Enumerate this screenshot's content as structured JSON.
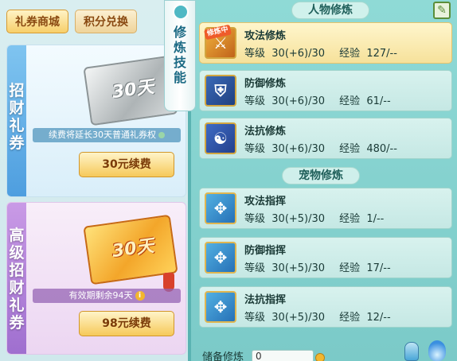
{
  "tabs": {
    "shop": "礼券商城",
    "points": "积分兑换"
  },
  "shop_cards": [
    {
      "side_label": [
        "招",
        "财",
        "礼",
        "券"
      ],
      "ticket_label": "30天",
      "info": "续费将延长30天普通礼券权",
      "button": "30元续费"
    },
    {
      "side_label": [
        "高",
        "级",
        "招",
        "财",
        "礼",
        "券"
      ],
      "ticket_label": "30天",
      "info": "有效期剩余94天",
      "button": "98元续费"
    }
  ],
  "vertical_tab": [
    "修",
    "炼",
    "技",
    "能"
  ],
  "sections": {
    "person": "人物修炼",
    "pet": "宠物修炼"
  },
  "labels": {
    "level": "等级",
    "exp": "经验",
    "badge_training": "修炼中",
    "reserve": "储备修炼"
  },
  "person_skills": [
    {
      "name": "攻法修炼",
      "level": "30(+6)/30",
      "exp": "127/--",
      "icon": "sword-icon"
    },
    {
      "name": "防御修炼",
      "level": "30(+6)/30",
      "exp": "61/--",
      "icon": "shield-icon"
    },
    {
      "name": "法抗修炼",
      "level": "30(+6)/30",
      "exp": "480/--",
      "icon": "yinyang-icon"
    }
  ],
  "pet_skills": [
    {
      "name": "攻法指挥",
      "level": "30(+5)/30",
      "exp": "1/--",
      "icon": "paw-attack-icon"
    },
    {
      "name": "防御指挥",
      "level": "30(+5)/30",
      "exp": "17/--",
      "icon": "paw-defense-icon"
    },
    {
      "name": "法抗指挥",
      "level": "30(+5)/30",
      "exp": "12/--",
      "icon": "paw-resist-icon"
    }
  ],
  "reserve_value": "0",
  "colors": {
    "accent_gold": "#f6c95a",
    "panel_teal": "#7bcac8",
    "selected_row": "#f6e19b"
  }
}
